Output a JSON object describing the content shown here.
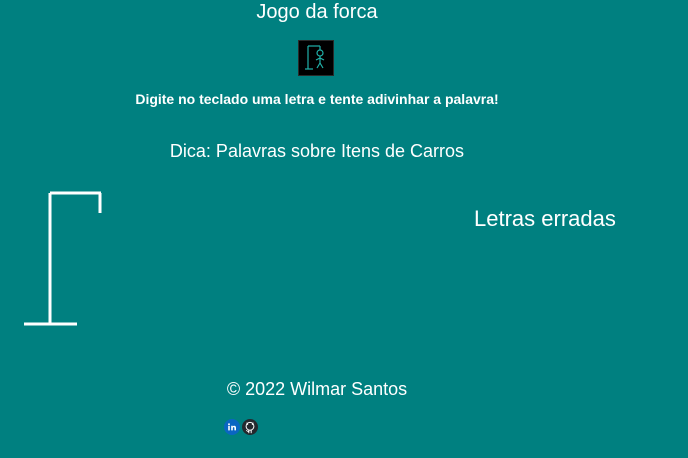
{
  "header": {
    "title": "Jogo da forca",
    "logo_icon": "hangman-icon"
  },
  "instructions": "Digite no teclado uma letra e tente adivinhar a palavra!",
  "hint": "Dica: Palavras sobre Itens de Carros",
  "game": {
    "gallows_icon": "gallows-icon",
    "wrong_letters_title": "Letras erradas",
    "wrong_letters": []
  },
  "footer": {
    "copyright": "© 2022 Wilmar Santos",
    "social": [
      {
        "icon": "linkedin-icon",
        "color": "#0a66c2"
      },
      {
        "icon": "github-icon",
        "color": "#24292e"
      }
    ]
  },
  "colors": {
    "background": "#008080",
    "text": "#ffffff"
  }
}
